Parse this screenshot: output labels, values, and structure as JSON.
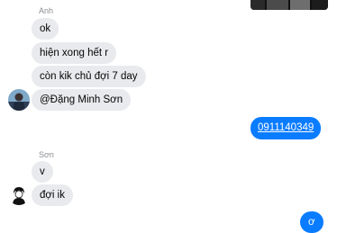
{
  "thread": {
    "groups": [
      {
        "sender": "Anh",
        "messages": [
          "ok",
          "hiện xong hết r",
          "còn kik chủ đợi 7 day",
          "@Đặng Minh Sơn"
        ]
      },
      {
        "direction": "outgoing",
        "messages": [
          "0911140349"
        ]
      },
      {
        "sender": "Sơn",
        "messages": [
          "v",
          "đợi ik"
        ]
      },
      {
        "direction": "outgoing",
        "messages": [
          "ơ"
        ]
      }
    ]
  },
  "colors": {
    "incoming_bubble": "#e9eaed",
    "outgoing_bubble": "#0a7cff",
    "sender_name": "#8a8d91"
  }
}
